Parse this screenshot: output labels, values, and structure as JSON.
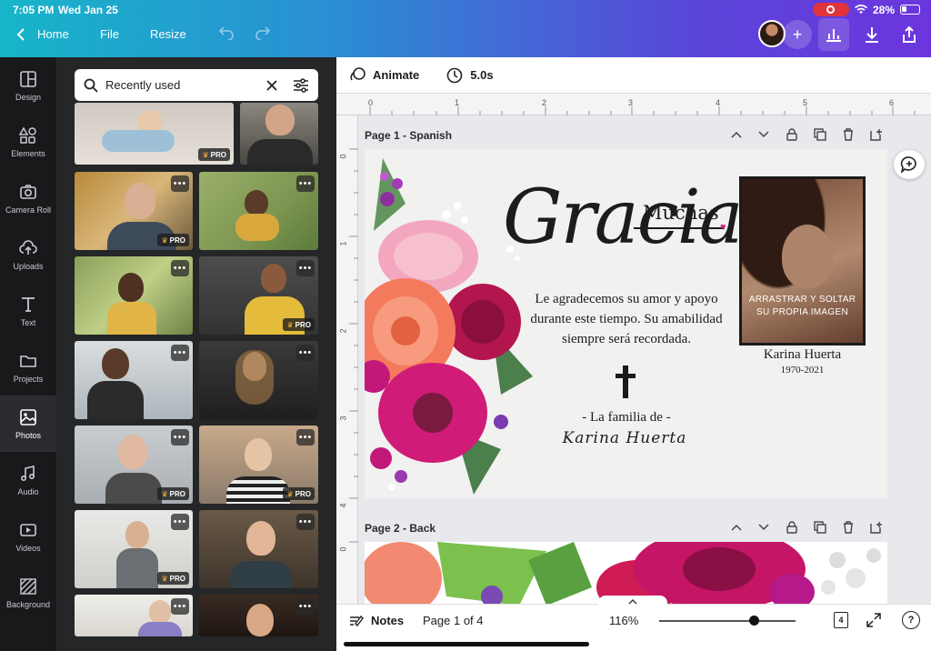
{
  "status_bar": {
    "time": "7:05 PM",
    "date": "Wed Jan 25",
    "battery": "28%"
  },
  "topbar": {
    "home_label": "Home",
    "file_label": "File",
    "resize_label": "Resize"
  },
  "sidebar": {
    "items": [
      {
        "label": "Design",
        "icon": "design-icon"
      },
      {
        "label": "Elements",
        "icon": "elements-icon"
      },
      {
        "label": "Camera Roll",
        "icon": "camera-icon"
      },
      {
        "label": "Uploads",
        "icon": "upload-icon"
      },
      {
        "label": "Text",
        "icon": "text-icon"
      },
      {
        "label": "Projects",
        "icon": "folder-icon"
      },
      {
        "label": "Photos",
        "icon": "photos-icon"
      },
      {
        "label": "Audio",
        "icon": "music-icon"
      },
      {
        "label": "Videos",
        "icon": "video-icon"
      },
      {
        "label": "Background",
        "icon": "background-icon"
      }
    ],
    "active": "Photos"
  },
  "photos_panel": {
    "search_value": "Recently used",
    "pro_label": "PRO",
    "more_label": "•••"
  },
  "editor": {
    "animate_label": "Animate",
    "duration_label": "5.0s",
    "ruler_h": [
      "0",
      "1",
      "2",
      "3",
      "4",
      "5",
      "6"
    ],
    "ruler_v": [
      "0",
      "1",
      "2",
      "3",
      "4"
    ],
    "ruler_v2": [
      "0"
    ],
    "page1_label": "Page 1 - Spanish",
    "page2_label": "Page 2 - Back"
  },
  "card": {
    "gracias": "Gracias",
    "muchas": "Muchas",
    "message": "Le agradecemos su amor y apoyo durante este tiempo. Su amabilidad siempre será recordada.",
    "family_label": "- La familia de -",
    "family_name": "Karina Huerta",
    "drop_text": "ARRASTRAR Y SOLTAR SU PROPIA IMAGEN",
    "person_name": "Karina Huerta",
    "person_years": "1970-2021"
  },
  "bottombar": {
    "notes_label": "Notes",
    "page_indicator": "Page 1 of 4",
    "zoom_level": "116%",
    "page_count": "4",
    "zoom_fraction": 0.69
  },
  "colors": {
    "accent": "#6c35de",
    "teal": "#17b5c9",
    "record": "#e0343d"
  }
}
